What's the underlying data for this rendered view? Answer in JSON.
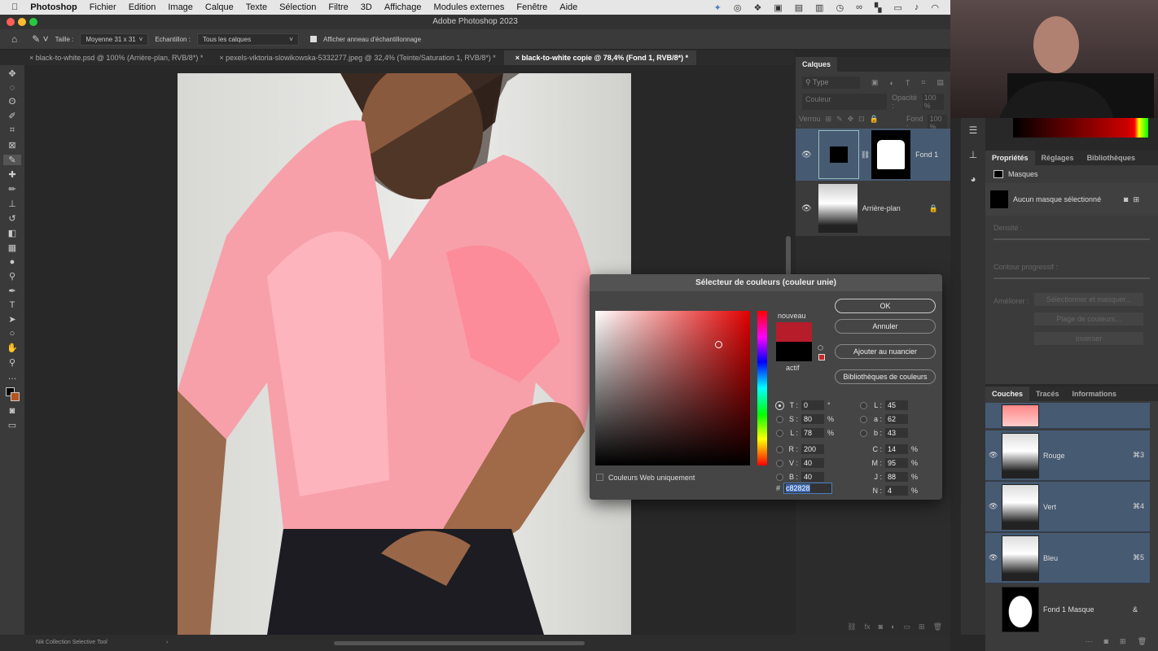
{
  "menubar": {
    "app": "Photoshop",
    "items": [
      "Fichier",
      "Edition",
      "Image",
      "Calque",
      "Texte",
      "Sélection",
      "Filtre",
      "3D",
      "Affichage",
      "Modules externes",
      "Fenêtre",
      "Aide"
    ],
    "status_icons": [
      "butterfly-icon",
      "creative-cloud-icon",
      "dropbox-icon",
      "camera-icon",
      "display-icon",
      "clipboard-icon",
      "clock-icon",
      "binoculars-icon",
      "grid-icon",
      "screen-icon",
      "volume-icon",
      "wifi-icon"
    ]
  },
  "window": {
    "title": "Adobe Photoshop 2023"
  },
  "options": {
    "taille_label": "Taille :",
    "taille_value": "Moyenne 31 x 31",
    "echantillon_label": "Echantillon :",
    "echantillon_value": "Tous les calques",
    "ring_label": "Afficher anneau d'échantillonnage",
    "ring_checked": true
  },
  "tabs": [
    {
      "label": "black-to-white.psd @ 100% (Arrière-plan, RVB/8*) *"
    },
    {
      "label": "pexels-viktoria-slowikowska-5332277.jpeg @ 32,4% (Teinte/Saturation 1, RVB/8*) *"
    },
    {
      "label": "black-to-white copie @ 78,4% (Fond 1, RVB/8*) *",
      "active": true
    }
  ],
  "layers": {
    "tab": "Calques",
    "filter": "Type",
    "blend": "Couleur",
    "opacity_label": "Opacité :",
    "opacity": "100 %",
    "lock_label": "Verrou :",
    "fill_label": "Fond :",
    "fill": "100 %",
    "items": [
      {
        "name": "Fond 1",
        "selected": true
      },
      {
        "name": "Arrière-plan",
        "locked": true
      }
    ]
  },
  "properties": {
    "tabs": [
      "Propriétés",
      "Réglages",
      "Bibliothèques"
    ],
    "section": "Masques",
    "mask_status": "Aucun masque sélectionné",
    "density_label": "Densité :",
    "feather_label": "Contour progressif :",
    "refine_label": "Améliorer :",
    "buttons": [
      "Sélectionner et masquer...",
      "Plage de couleurs...",
      "Inverser"
    ]
  },
  "channels": {
    "tabs": [
      "Couches",
      "Tracés",
      "Informations"
    ],
    "items": [
      {
        "name": "Rouge",
        "shortcut": "⌘3"
      },
      {
        "name": "Vert",
        "shortcut": "⌘4"
      },
      {
        "name": "Bleu",
        "shortcut": "⌘5"
      },
      {
        "name": "Fond 1 Masque",
        "shortcut": "&"
      }
    ]
  },
  "dialog": {
    "title": "Sélecteur de couleurs (couleur unie)",
    "new_label": "nouveau",
    "current_label": "actif",
    "new_color": "#b71c2a",
    "current_color": "#000000",
    "buttons": {
      "ok": "OK",
      "cancel": "Annuler",
      "add": "Ajouter au nuancier",
      "libs": "Bibliothèques de couleurs"
    },
    "web_only": "Couleurs Web uniquement",
    "hsb": [
      {
        "label": "T :",
        "value": "0",
        "unit": "°",
        "selected": true
      },
      {
        "label": "S :",
        "value": "80",
        "unit": "%"
      },
      {
        "label": "L :",
        "value": "78",
        "unit": "%"
      }
    ],
    "rgb": [
      {
        "label": "R :",
        "value": "200"
      },
      {
        "label": "V :",
        "value": "40"
      },
      {
        "label": "B :",
        "value": "40"
      }
    ],
    "lab": [
      {
        "label": "L :",
        "value": "45"
      },
      {
        "label": "a :",
        "value": "62"
      },
      {
        "label": "b :",
        "value": "43"
      }
    ],
    "cmyk": [
      {
        "label": "C :",
        "value": "14",
        "unit": "%"
      },
      {
        "label": "M :",
        "value": "95",
        "unit": "%"
      },
      {
        "label": "J :",
        "value": "88",
        "unit": "%"
      },
      {
        "label": "N :",
        "value": "4",
        "unit": "%"
      }
    ],
    "hex_label": "#",
    "hex": "c82828"
  },
  "status": {
    "text": "Nik Collection Selective Tool"
  }
}
